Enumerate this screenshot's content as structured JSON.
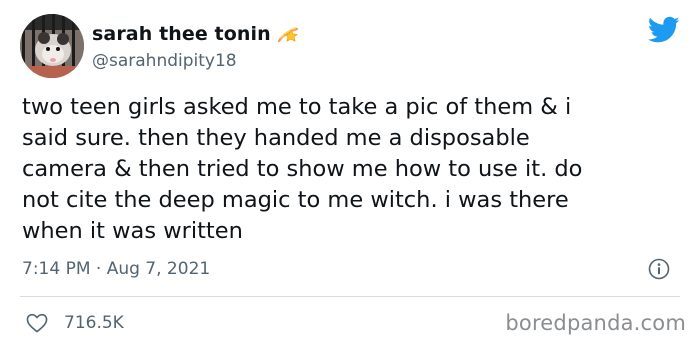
{
  "author": {
    "display_name": "sarah thee tonin",
    "handle": "@sarahndipity18",
    "name_emoji": "shooting-star-emoji",
    "avatar_icon": "opossum-avatar"
  },
  "brand": {
    "logo_icon": "twitter-bird-icon",
    "logo_color": "#1d9bf0"
  },
  "tweet": {
    "text": "two teen girls asked me to take a pic of them & i\nsaid sure. then they handed me a disposable\ncamera & then tried to show me how to use it. do\nnot cite the deep magic to me witch. i was there\nwhen it was written",
    "timestamp": "7:14 PM · Aug 7, 2021"
  },
  "actions": {
    "info_icon": "info-icon",
    "like_icon": "heart-icon",
    "like_count": "716.5K"
  },
  "watermark": {
    "text": "boredpanda.com"
  }
}
